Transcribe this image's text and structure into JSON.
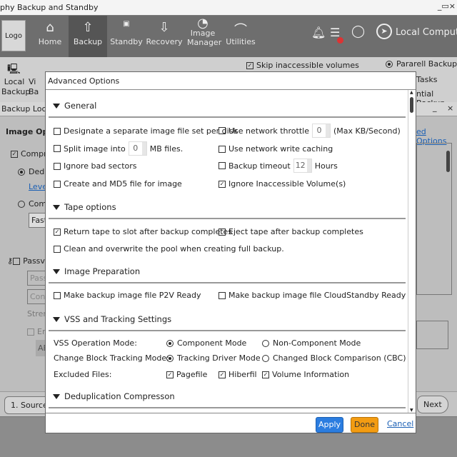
{
  "app": {
    "title": "phy Backup and Standby",
    "window_controls": "_▭×"
  },
  "nav": {
    "logo": "Logo",
    "items": [
      {
        "label": "Home",
        "icon": "home-icon"
      },
      {
        "label": "Backup",
        "icon": "upload-icon",
        "selected": true
      },
      {
        "label": "Standby",
        "icon": "sd-icon"
      },
      {
        "label": "Recovery",
        "icon": "download-icon"
      },
      {
        "label": "Image Manager",
        "icon": "image-manager-icon"
      },
      {
        "label": "Utilities",
        "icon": "utilities-icon"
      }
    ],
    "local_computer": "Local Computer"
  },
  "toolbar": {
    "items": [
      "Local Backup",
      "Vi Ba"
    ],
    "skip_inaccessible": "Skip inaccessible volumes",
    "parallel_backup": "Pararell Backup",
    "tasks": "Tasks",
    "sequential_backup": "ntial Backup"
  },
  "subwindow": {
    "title": "Backup Local",
    "min": "_",
    "close": "×",
    "image_options": "Image Optio",
    "compress": "Compre",
    "dedup": "Dedu",
    "level_link": "Level",
    "comp": "Comr",
    "fast": "Fast",
    "password": "Passv",
    "pass_ph": "Passv",
    "confirm_ph": "Confi",
    "strength": "Streng",
    "encrypt": "En",
    "aes": "AE",
    "advanced_link": "ed Options"
  },
  "bottom": {
    "source": "1. Source",
    "next": "Next"
  },
  "modal": {
    "title": "Advanced Options",
    "general": {
      "header": "General",
      "designate": "Designate a separate image file set per disk",
      "split": "Split image into",
      "split_value": "0",
      "split_unit": "MB files.",
      "ignore_bad": "Ignore bad sectors",
      "md5": "Create and MD5 file for image",
      "throttle": "Use network throttle",
      "throttle_value": "0",
      "throttle_unit": "(Max KB/Second)",
      "write_caching": "Use network write caching",
      "timeout": "Backup timeout",
      "timeout_value": "12",
      "timeout_unit": "Hours",
      "ignore_inaccessible": "Ignore Inaccessible Volume(s)"
    },
    "tape": {
      "header": "Tape options",
      "return": "Return tape to slot after backup completes",
      "eject": "Eject tape after backup completes",
      "clean": "Clean and overwrite the pool when creating full backup."
    },
    "image_prep": {
      "header": "Image Preparation",
      "p2v": "Make backup image file P2V Ready",
      "cloud": "Make backup image file CloudStandby Ready"
    },
    "vss": {
      "header": "VSS and Tracking Settings",
      "op_mode": "VSS Operation Mode:",
      "component": "Component Mode",
      "non_component": "Non-Component Mode",
      "cbt": "Change Block Tracking Mode:",
      "tracking_driver": "Tracking Driver Mode",
      "cbc": "Changed Block Comparison (CBC) Mode",
      "excluded": "Excluded Files:",
      "pagefile": "Pagefile",
      "hiberfil": "Hiberfil",
      "volume_info": "Volume Information"
    },
    "dedup": {
      "header": "Deduplication Compresson"
    },
    "apply": "Apply",
    "done": "Done",
    "cancel": "Cancel"
  },
  "colors": {
    "apply": "#2b7de0",
    "done": "#f39c12",
    "link": "#1a5fb4",
    "nav": "#6e6e6e"
  }
}
